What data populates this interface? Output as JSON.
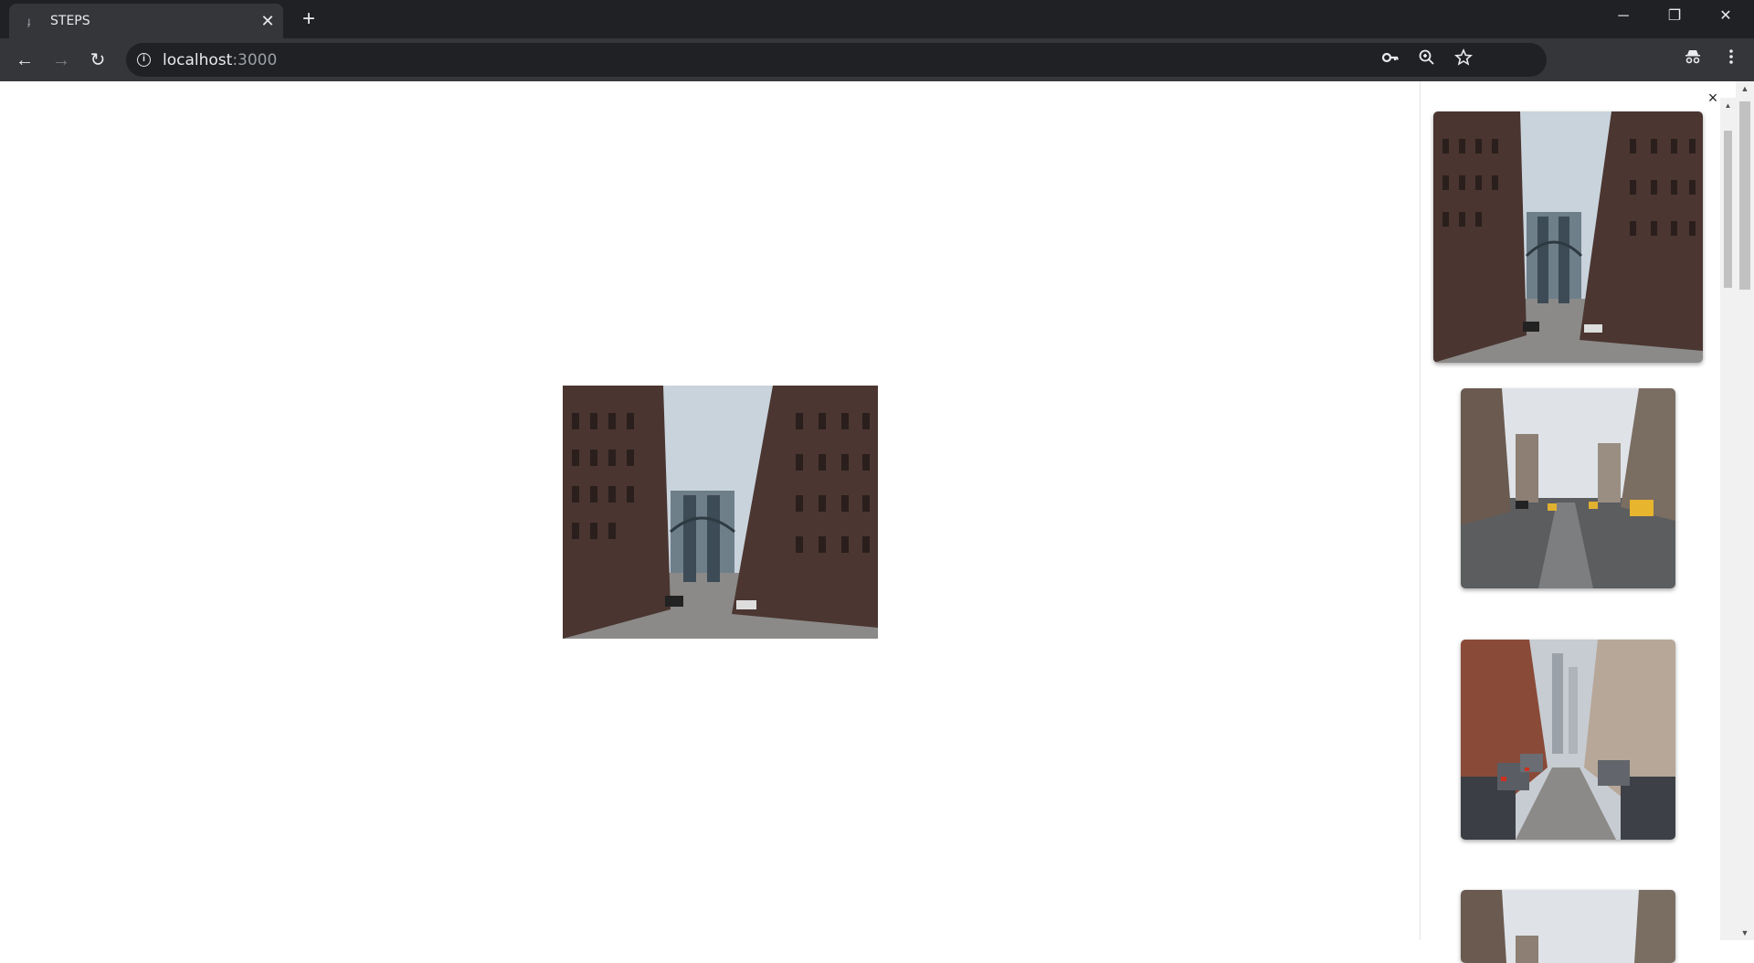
{
  "browser": {
    "tab_title": "STEPS",
    "tab_close": "✕",
    "new_tab": "+",
    "window_minimize": "─",
    "window_restore": "❐",
    "window_close": "✕",
    "url_host": "localhost",
    "url_port": ":3000",
    "nav_back": "←",
    "nav_forward": "→",
    "nav_reload": "↻"
  },
  "panel": {
    "close_label": "×",
    "thumbnails": [
      {
        "name": "manhattan-bridge-street",
        "selected": true
      },
      {
        "name": "city-avenue-taxis",
        "selected": false
      },
      {
        "name": "cobblestone-street-cars",
        "selected": false
      },
      {
        "name": "city-avenue-taxis-repeat",
        "selected": false
      }
    ]
  },
  "colors": {
    "chrome_dark": "#202124",
    "chrome_toolbar": "#35363a",
    "brick": "#4a3530",
    "sky": "#c9d3dc"
  }
}
